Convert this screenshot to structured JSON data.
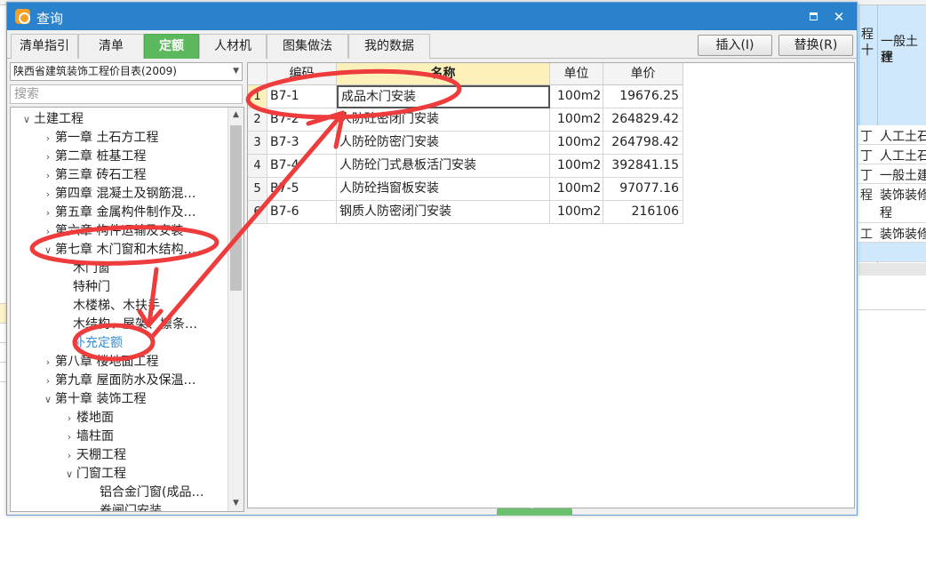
{
  "background": {
    "header": {
      "col1": "程",
      "col1b": "十",
      "col2a": "一般土建",
      "col2b": "程"
    },
    "rows": [
      {
        "c1": "丁",
        "c2": "人工土石",
        "tall": false,
        "sel": false
      },
      {
        "c1": "丁",
        "c2": "人工土石",
        "tall": false,
        "sel": false
      },
      {
        "c1": "丁",
        "c2": "一般土建",
        "tall": false,
        "sel": false
      },
      {
        "c1": "程",
        "c2": "装饰装修",
        "c2b": "程",
        "tall": true,
        "sel": false
      },
      {
        "c1": "工",
        "c2": "装饰装修",
        "tall": false,
        "sel": false
      },
      {
        "c1": "",
        "c2": "",
        "tall": false,
        "sel": true
      }
    ]
  },
  "window": {
    "title": "查询"
  },
  "tabs": [
    {
      "label": "清单指引",
      "active": false
    },
    {
      "label": "清单",
      "active": false
    },
    {
      "label": "定额",
      "active": true
    },
    {
      "label": "人材机",
      "active": false
    },
    {
      "label": "图集做法",
      "active": false
    },
    {
      "label": "我的数据",
      "active": false
    }
  ],
  "buttons": {
    "insert": "插入(I)",
    "replace": "替换(R)"
  },
  "left_panel": {
    "catalog": "陕西省建筑装饰工程价目表(2009)",
    "search_placeholder": "搜索",
    "tree": [
      {
        "label": "土建工程",
        "depth": 0,
        "arrow": "expanded"
      },
      {
        "label": "第一章 土石方工程",
        "depth": 1,
        "arrow": "collapsed"
      },
      {
        "label": "第二章 桩基工程",
        "depth": 1,
        "arrow": "collapsed"
      },
      {
        "label": "第三章 砖石工程",
        "depth": 1,
        "arrow": "collapsed"
      },
      {
        "label": "第四章 混凝土及钢筋混…",
        "depth": 1,
        "arrow": "collapsed"
      },
      {
        "label": "第五章 金属构件制作及…",
        "depth": 1,
        "arrow": "collapsed"
      },
      {
        "label": "第六章 构件运输及安装",
        "depth": 1,
        "arrow": "collapsed"
      },
      {
        "label": "第七章 木门窗和木结构…",
        "depth": 1,
        "arrow": "expanded"
      },
      {
        "label": "木门窗",
        "depth": 2,
        "arrow": "none"
      },
      {
        "label": "特种门",
        "depth": 2,
        "arrow": "none"
      },
      {
        "label": "木楼梯、木扶手",
        "depth": 2,
        "arrow": "none"
      },
      {
        "label": "木结构、屋架、檩条…",
        "depth": 2,
        "arrow": "none"
      },
      {
        "label": "补充定额",
        "depth": 2,
        "arrow": "none",
        "link": true
      },
      {
        "label": "第八章 楼地面工程",
        "depth": 1,
        "arrow": "collapsed"
      },
      {
        "label": "第九章 屋面防水及保温…",
        "depth": 1,
        "arrow": "collapsed"
      },
      {
        "label": "第十章 装饰工程",
        "depth": 1,
        "arrow": "expanded"
      },
      {
        "label": "楼地面",
        "depth": 2,
        "arrow": "collapsed"
      },
      {
        "label": "墙柱面",
        "depth": 2,
        "arrow": "collapsed"
      },
      {
        "label": "天棚工程",
        "depth": 2,
        "arrow": "collapsed"
      },
      {
        "label": "门窗工程",
        "depth": 2,
        "arrow": "expanded"
      },
      {
        "label": "铝合金门窗(成品…",
        "depth": 3,
        "arrow": "none"
      },
      {
        "label": "卷闸门安装",
        "depth": 3,
        "arrow": "none"
      }
    ]
  },
  "grid": {
    "headers": {
      "code": "编码",
      "name": "名称",
      "unit": "单位",
      "price": "单价"
    },
    "rows": [
      {
        "n": "1",
        "code": "B7-1",
        "name": "成品木门安装",
        "unit": "100m2",
        "price": "19676.25"
      },
      {
        "n": "2",
        "code": "B7-2",
        "name": "人防砼密闭门安装",
        "unit": "100m2",
        "price": "264829.42"
      },
      {
        "n": "3",
        "code": "B7-3",
        "name": "人防砼防密门安装",
        "unit": "100m2",
        "price": "264798.42"
      },
      {
        "n": "4",
        "code": "B7-4",
        "name": "人防砼门式悬板活门安装",
        "unit": "100m2",
        "price": "392841.15"
      },
      {
        "n": "5",
        "code": "B7-5",
        "name": "人防砼挡窗板安装",
        "unit": "100m2",
        "price": "97077.16"
      },
      {
        "n": "6",
        "code": "B7-6",
        "name": "钢质人防密闭门安装",
        "unit": "100m2",
        "price": "216106"
      }
    ]
  },
  "colors": {
    "titlebar": "#2b82cc",
    "active_tab": "#5cb85c",
    "annotation": "#ee3b3b",
    "link": "#3a8ed8"
  }
}
